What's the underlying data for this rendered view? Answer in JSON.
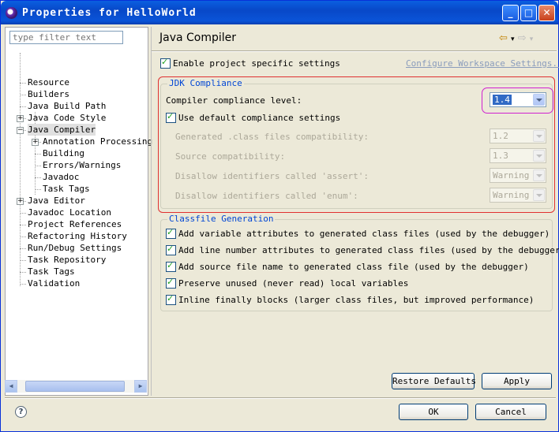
{
  "window": {
    "title": "Properties for HelloWorld"
  },
  "filter": {
    "placeholder": "type filter text"
  },
  "tree": {
    "items": [
      {
        "label": "Resource"
      },
      {
        "label": "Builders"
      },
      {
        "label": "Java Build Path"
      },
      {
        "label": "Java Code Style"
      },
      {
        "label": "Java Compiler"
      },
      {
        "label": "Annotation Processing"
      },
      {
        "label": "Building"
      },
      {
        "label": "Errors/Warnings"
      },
      {
        "label": "Javadoc"
      },
      {
        "label": "Task Tags"
      },
      {
        "label": "Java Editor"
      },
      {
        "label": "Javadoc Location"
      },
      {
        "label": "Project References"
      },
      {
        "label": "Refactoring History"
      },
      {
        "label": "Run/Debug Settings"
      },
      {
        "label": "Task Repository"
      },
      {
        "label": "Task Tags"
      },
      {
        "label": "Validation"
      }
    ]
  },
  "page": {
    "title": "Java Compiler",
    "enable_project_label": "Enable project specific settings",
    "configure_link": "Configure Workspace Settings...",
    "jdk": {
      "group_title": "JDK Compliance",
      "compliance_label": "Compiler compliance level:",
      "compliance_value": "1.4",
      "use_default_label": "Use default compliance settings",
      "generated_label": "Generated .class files compatibility:",
      "generated_value": "1.2",
      "source_label": "Source compatibility:",
      "source_value": "1.3",
      "assert_label": "Disallow identifiers called 'assert':",
      "assert_value": "Warning",
      "enum_label": "Disallow identifiers called 'enum':",
      "enum_value": "Warning"
    },
    "classfile": {
      "group_title": "Classfile Generation",
      "options": [
        "Add variable attributes to generated class files (used by the debugger)",
        "Add line number attributes to generated class files (used by the debugger)",
        "Add source file name to generated class file (used by the debugger)",
        "Preserve unused (never read) local variables",
        "Inline finally blocks (larger class files, but improved performance)"
      ]
    },
    "restore_defaults": "Restore Defaults",
    "apply": "Apply"
  },
  "footer": {
    "ok": "OK",
    "cancel": "Cancel"
  }
}
